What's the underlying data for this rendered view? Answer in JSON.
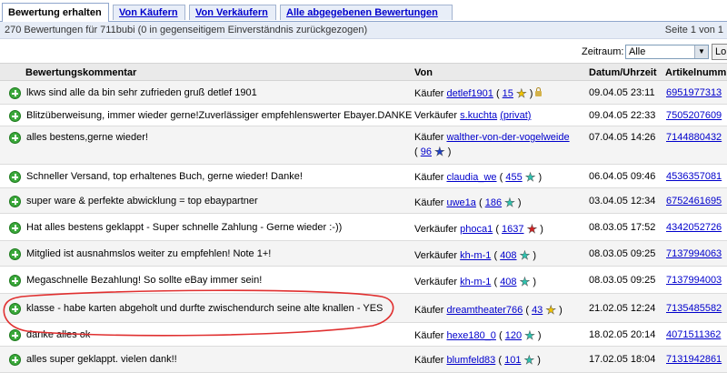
{
  "tabs": [
    {
      "label": "Bewertung erhalten",
      "active": true
    },
    {
      "label": "Von Käufern",
      "active": false
    },
    {
      "label": "Von Verkäufern",
      "active": false
    },
    {
      "label": "Alle abgegebenen Bewertungen",
      "active": false
    }
  ],
  "summary": {
    "text": "270 Bewertungen für 711bubi (0 in gegenseitigem Einverständnis zurückgezogen)",
    "pages": "Seite 1 von 1"
  },
  "filter": {
    "label": "Zeitraum:",
    "value": "Alle",
    "button": "Lo"
  },
  "columns": {
    "comment": "Bewertungskommentar",
    "from": "Von",
    "date": "Datum/Uhrzeit",
    "item": "Artikelnumm"
  },
  "colors": {
    "star_yellow": "#f2c400",
    "star_turquoise": "#2ec4b0",
    "star_blue": "#1b3fc8",
    "star_red": "#d42020",
    "positive": "#3aa83a",
    "annotation": "#e03030"
  },
  "rows": [
    {
      "comment": "lkws sind alle da bin sehr zufrieden gruß detlef 1901",
      "role": "Käufer",
      "user": "detlef1901",
      "score": "15",
      "star": "yellow",
      "lock": true,
      "date": "09.04.05 23:11",
      "item": "6951977313"
    },
    {
      "comment": "Blitzüberweisung, immer wieder gerne!Zuverlässiger empfehlenswerter Ebayer.DANKE",
      "role": "Verkäufer",
      "user": "s.kuchta",
      "private": "(privat)",
      "date": "09.04.05 22:33",
      "item": "7505207609"
    },
    {
      "comment": "alles bestens,gerne wieder!",
      "role": "Käufer",
      "user": "walther-von-der-vogelweide",
      "score": "96",
      "star": "blue",
      "date": "07.04.05 14:26",
      "item": "7144880432"
    },
    {
      "comment": "Schneller Versand, top erhaltenes Buch, gerne wieder! Danke!",
      "role": "Käufer",
      "user": "claudia_we",
      "score": "455",
      "star": "turquoise",
      "date": "06.04.05 09:46",
      "item": "4536357081"
    },
    {
      "comment": "super ware & perfekte abwicklung = top ebaypartner",
      "role": "Käufer",
      "user": "uwe1a",
      "score": "186",
      "star": "turquoise",
      "date": "03.04.05 12:34",
      "item": "6752461695"
    },
    {
      "comment": "Hat alles bestens geklappt - Super schnelle Zahlung - Gerne wieder :-))",
      "role": "Verkäufer",
      "user": "phoca1",
      "score": "1637",
      "star": "red",
      "date": "08.03.05 17:52",
      "item": "4342052726"
    },
    {
      "comment": "Mitglied ist ausnahmslos weiter zu empfehlen! Note 1+!",
      "role": "Verkäufer",
      "user": "kh-m-1",
      "score": "408",
      "star": "turquoise",
      "date": "08.03.05 09:25",
      "item": "7137994063"
    },
    {
      "comment": "Megaschnelle Bezahlung! So sollte eBay immer sein!",
      "role": "Verkäufer",
      "user": "kh-m-1",
      "score": "408",
      "star": "turquoise",
      "date": "08.03.05 09:25",
      "item": "7137994003"
    },
    {
      "comment": "klasse - habe karten abgeholt und durfte zwischendurch seine alte knallen - YES",
      "role": "Käufer",
      "user": "dreamtheater766",
      "score": "43",
      "star": "yellow",
      "date": "21.02.05 12:24",
      "item": "7135485582"
    },
    {
      "comment": "danke alles ok",
      "role": "Käufer",
      "user": "hexe180_0",
      "score": "120",
      "star": "turquoise",
      "date": "18.02.05 20:14",
      "item": "4071511362"
    },
    {
      "comment": "alles super geklappt. vielen dank!!",
      "role": "Käufer",
      "user": "blumfeld83",
      "score": "101",
      "star": "turquoise",
      "date": "17.02.05 18:04",
      "item": "7131942861"
    }
  ]
}
